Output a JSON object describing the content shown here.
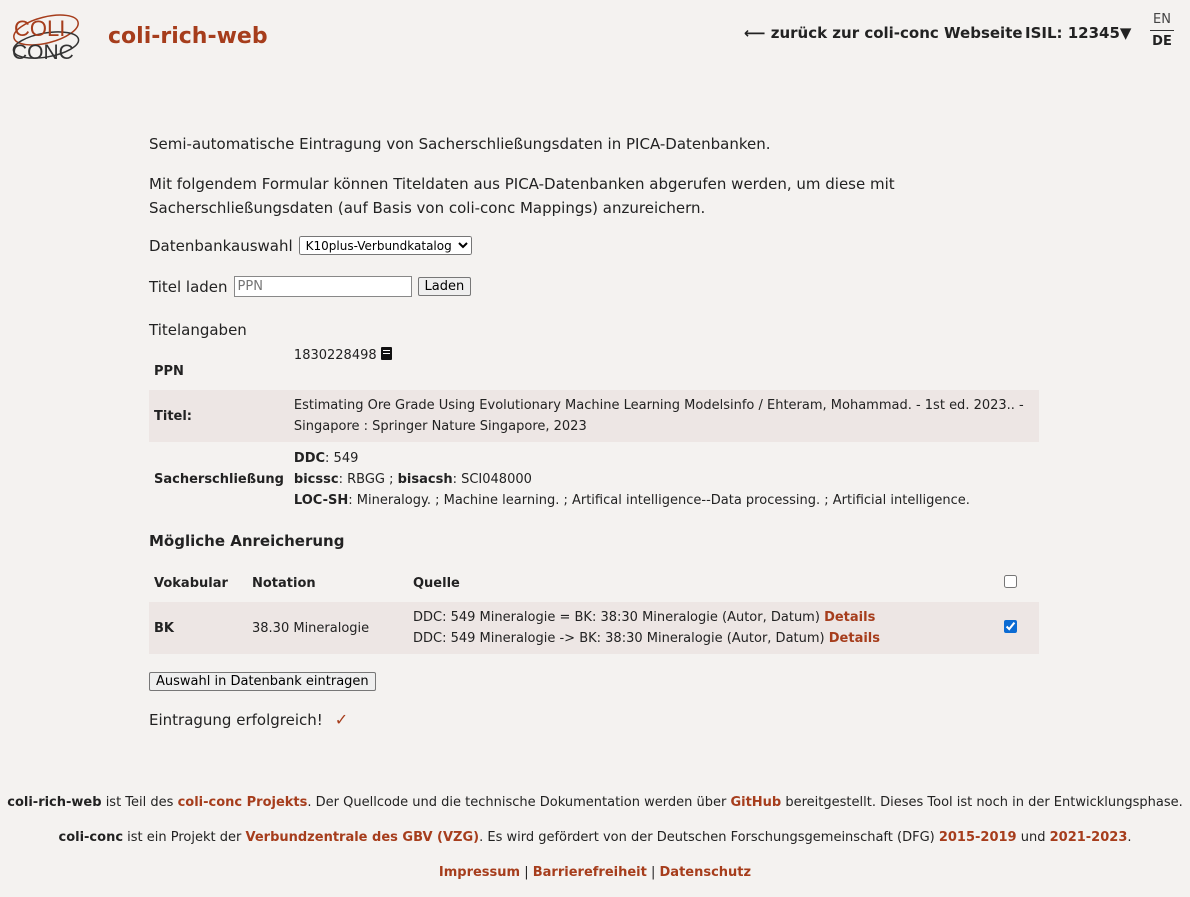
{
  "header": {
    "logo_line1": "COLI",
    "logo_line2": "CONC",
    "app_title": "coli-rich-web",
    "back_link": "⟵ zurück zur coli-conc Webseite",
    "isil": "ISIL: 12345▼",
    "lang_en": "EN",
    "lang_de": "DE"
  },
  "intro": {
    "line1": "Semi-automatische Eintragung von Sacherschließungsdaten in PICA-Datenbanken.",
    "line2": "Mit folgendem Formular können Titeldaten aus PICA-Datenbanken abgerufen werden, um diese mit Sacherschließungsdaten (auf Basis von coli-conc Mappings) anzureichern."
  },
  "database": {
    "label": "Datenbankauswahl",
    "selected": "K10plus-Verbundkatalog"
  },
  "load": {
    "label": "Titel laden",
    "placeholder": "PPN",
    "button": "Laden"
  },
  "title_info": {
    "heading": "Titelangaben",
    "ppn_label": "PPN",
    "ppn_value": "1830228498",
    "titel_label": "Titel:",
    "titel_value": "Estimating Ore Grade Using Evolutionary Machine Learning Modelsinfo / Ehteram, Mohammad. - 1st ed. 2023.. - Singapore : Springer Nature Singapore, 2023",
    "subject_label": "Sacherschließung",
    "ddc_key": "DDC",
    "ddc_value": ": 549",
    "bicssc_key": "bicssc",
    "bicssc_value": ": RBGG ; ",
    "bisacsh_key": "bisacsh",
    "bisacsh_value": ": SCI048000",
    "locsh_key": "LOC-SH",
    "locsh_value": ": Mineralogy. ; Machine learning. ; Artifical intelligence--Data processing. ; Artificial intelligence."
  },
  "enrichment": {
    "heading": "Mögliche Anreicherung",
    "col_vocab": "Vokabular",
    "col_notation": "Notation",
    "col_source": "Quelle",
    "rows": [
      {
        "vocab": "BK",
        "notation": "38.30 Mineralogie",
        "source1": "DDC: 549 Mineralogie = BK: 38:30 Mineralogie (Autor, Datum) ",
        "source2": "DDC: 549 Mineralogie -> BK: 38:30 Mineralogie (Autor, Datum) ",
        "details": "Details"
      }
    ]
  },
  "submit_button": "Auswahl in Datenbank eintragen",
  "success_text": "Eintragung erfolgreich!",
  "success_icon": "✓",
  "footer": {
    "line1_app": "coli-rich-web",
    "line1_a": " ist Teil des ",
    "line1_link1": "coli-conc Projekts",
    "line1_b": ". Der Quellcode und die technische Dokumentation werden über ",
    "line1_link2": "GitHub",
    "line1_c": " bereitgestellt. Dieses Tool ist noch in der Entwicklungsphase.",
    "line2_name": "coli-conc",
    "line2_a": " ist ein Projekt der ",
    "line2_link1": "Verbundzentrale des GBV (VZG)",
    "line2_b": ". Es wird gefördert von der Deutschen Forschungsgemeinschaft (DFG) ",
    "line2_link2": "2015-2019",
    "line2_c": " und ",
    "line2_link3": "2021-2023",
    "line2_d": ".",
    "impressum": "Impressum",
    "barrierefreiheit": "Barrierefreiheit",
    "datenschutz": "Datenschutz",
    "sep": " | "
  }
}
